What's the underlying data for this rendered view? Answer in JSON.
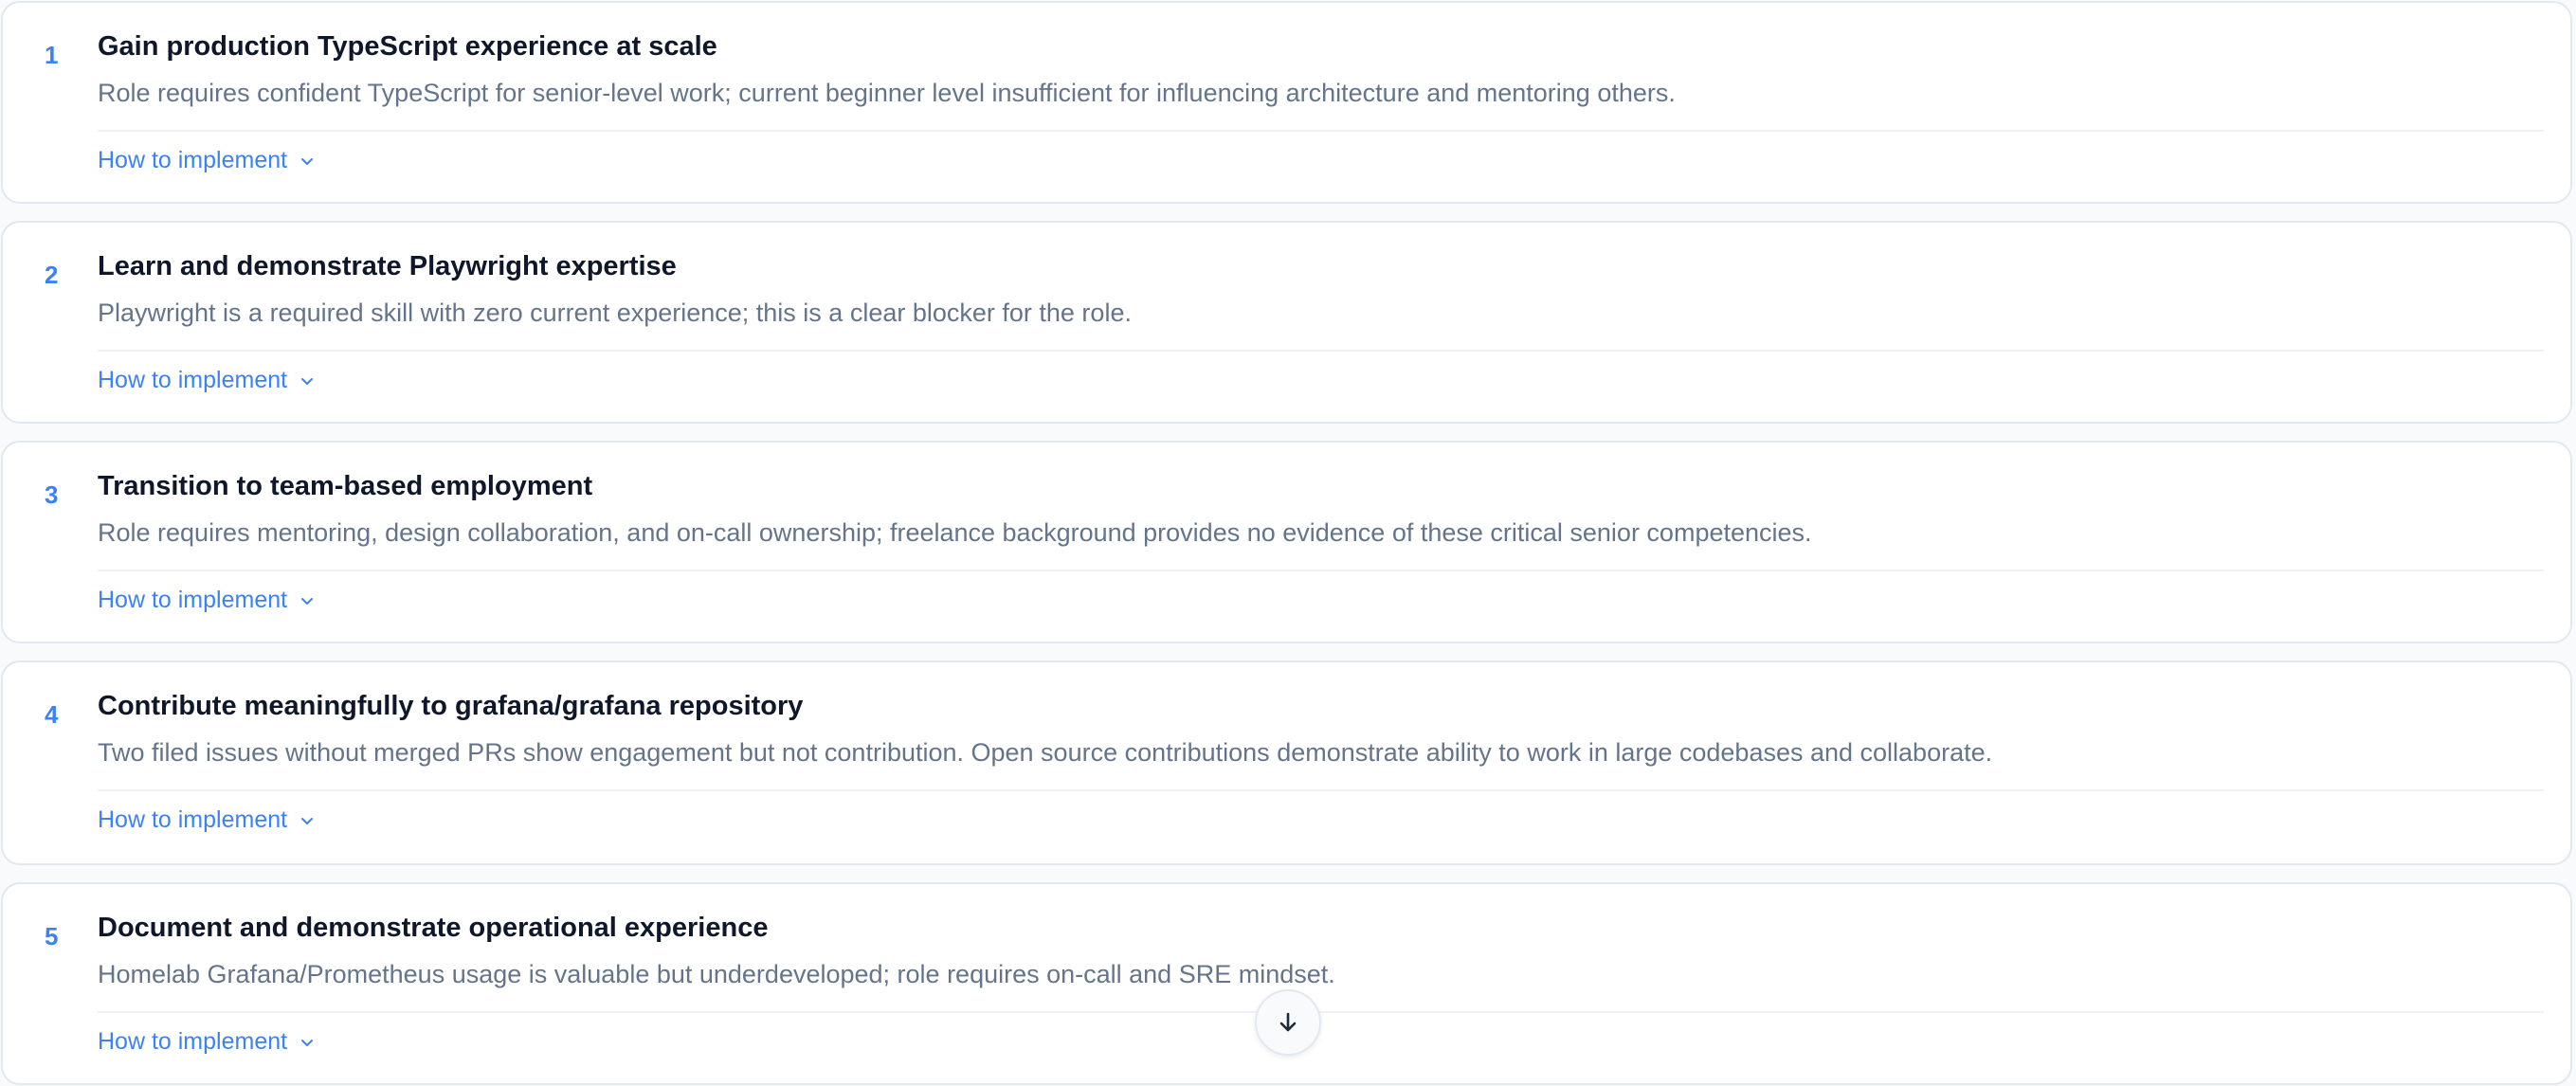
{
  "recommendations": [
    {
      "number": "1",
      "title": "Gain production TypeScript experience at scale",
      "description": "Role requires confident TypeScript for senior-level work; current beginner level insufficient for influencing architecture and mentoring others.",
      "link_label": "How to implement"
    },
    {
      "number": "2",
      "title": "Learn and demonstrate Playwright expertise",
      "description": "Playwright is a required skill with zero current experience; this is a clear blocker for the role.",
      "link_label": "How to implement"
    },
    {
      "number": "3",
      "title": "Transition to team-based employment",
      "description": "Role requires mentoring, design collaboration, and on-call ownership; freelance background provides no evidence of these critical senior competencies.",
      "link_label": "How to implement"
    },
    {
      "number": "4",
      "title": "Contribute meaningfully to grafana/grafana repository",
      "description": "Two filed issues without merged PRs show engagement but not contribution. Open source contributions demonstrate ability to work in large codebases and collaborate.",
      "link_label": "How to implement"
    },
    {
      "number": "5",
      "title": "Document and demonstrate operational experience",
      "description": "Homelab Grafana/Prometheus usage is valuable but underdeveloped; role requires on-call and SRE mindset.",
      "link_label": "How to implement"
    }
  ],
  "icons": {
    "expand": "chevron-down-icon",
    "scroll": "arrow-down-icon"
  },
  "colors": {
    "accent": "#3b82f6",
    "title": "#0f172a",
    "description": "#64748b",
    "border": "#e2e8f0",
    "background": "#f8fafc"
  }
}
